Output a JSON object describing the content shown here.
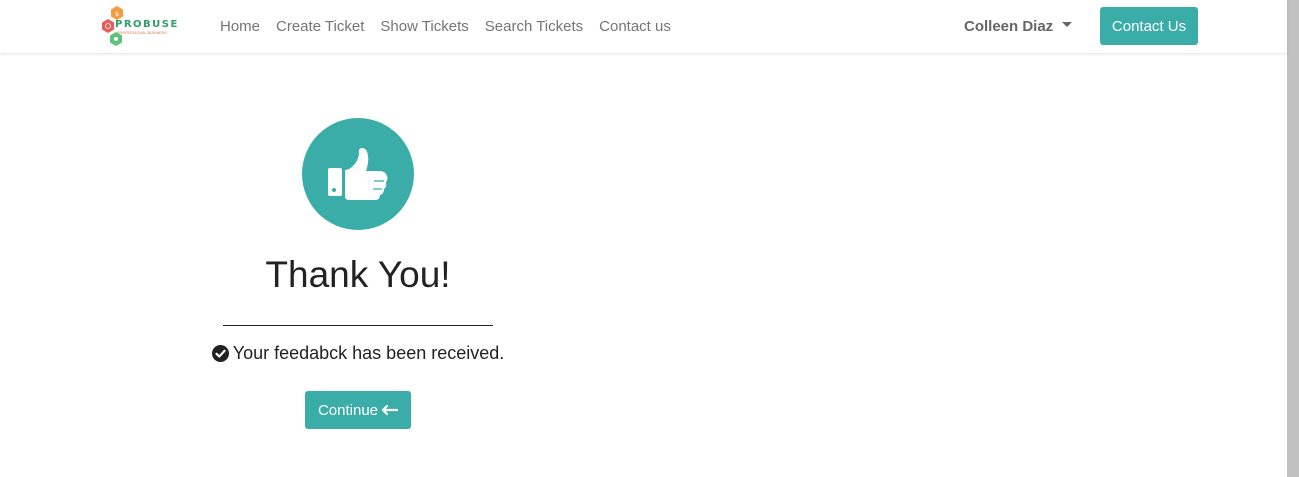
{
  "brand": {
    "name": "PROBUSE",
    "tagline": "PROFESSIONAL BUSINESS"
  },
  "nav": {
    "links": [
      {
        "label": "Home"
      },
      {
        "label": "Create Ticket"
      },
      {
        "label": "Show Tickets"
      },
      {
        "label": "Search Tickets"
      },
      {
        "label": "Contact us"
      }
    ],
    "user_name": "Colleen Diaz",
    "contact_button": "Contact Us"
  },
  "main": {
    "icon": "thumbs-up-icon",
    "title": "Thank You!",
    "message_icon": "check-circle-icon",
    "message": "Your feedabck has been received.",
    "continue_label": "Continue",
    "continue_icon": "arrow-left-icon"
  },
  "colors": {
    "accent": "#3aada8",
    "text": "#222222",
    "nav_text": "#757575"
  }
}
